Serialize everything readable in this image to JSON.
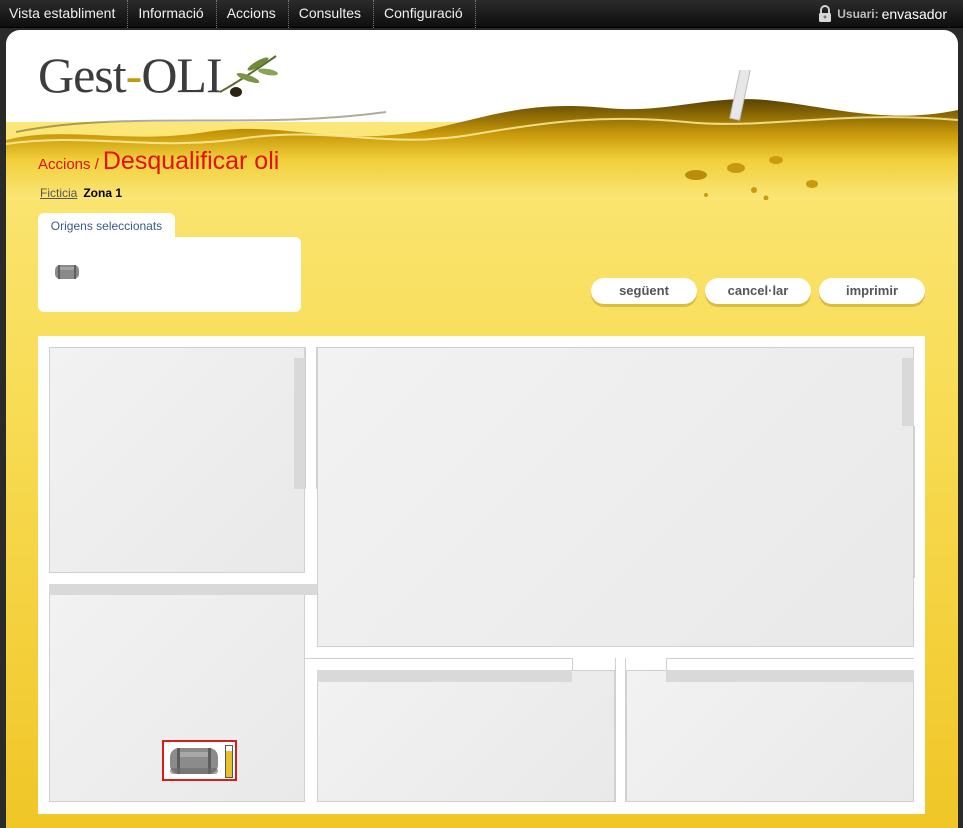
{
  "topnav": {
    "items": [
      {
        "label": "Vista establiment"
      },
      {
        "label": "Informació"
      },
      {
        "label": "Accions"
      },
      {
        "label": "Consultes"
      },
      {
        "label": "Configuració"
      }
    ],
    "user_label": "Usuari:",
    "user_name": "envasador"
  },
  "logo": {
    "part1": "Gest",
    "dash": "-",
    "part2": "OLI"
  },
  "heading": {
    "crumb": "Accions /",
    "title": "Desqualificar oli"
  },
  "subcrumb": {
    "establishment": "Ficticia",
    "zone": "Zona 1"
  },
  "origins": {
    "tab_label": "Origens seleccionats"
  },
  "buttons": {
    "next": "següent",
    "cancel": "cancel·lar",
    "print": "imprimir"
  },
  "tank": {
    "fill_fraction": 0.85
  },
  "colors": {
    "accent_red": "#e0110f",
    "oil_yellow": "#f8dc55",
    "tab_text": "#3a5a88"
  }
}
